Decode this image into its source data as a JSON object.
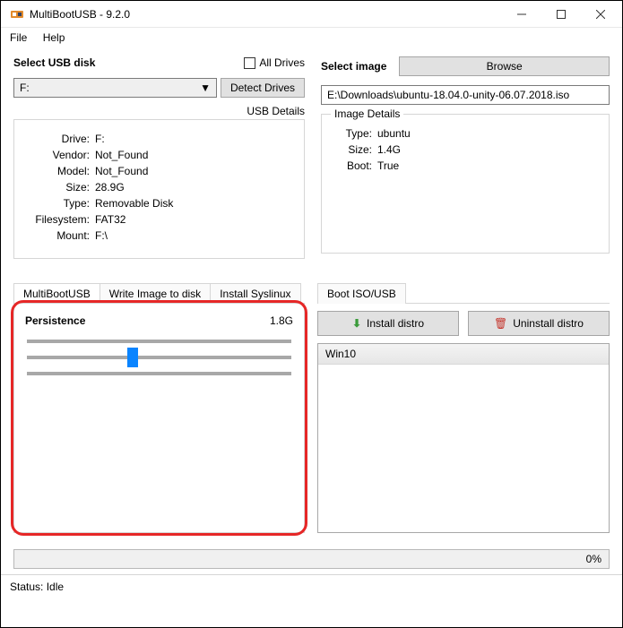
{
  "window": {
    "title": "MultiBootUSB - 9.2.0"
  },
  "menu": {
    "file": "File",
    "help": "Help"
  },
  "usb": {
    "select_label": "Select USB disk",
    "all_drives": "All Drives",
    "selected": "F:",
    "detect": "Detect Drives",
    "details_label": "USB Details",
    "drive_k": "Drive:",
    "drive_v": "F:",
    "vendor_k": "Vendor:",
    "vendor_v": "Not_Found",
    "model_k": "Model:",
    "model_v": "Not_Found",
    "size_k": "Size:",
    "size_v": "28.9G",
    "type_k": "Type:",
    "type_v": "Removable Disk",
    "fs_k": "Filesystem:",
    "fs_v": "FAT32",
    "mount_k": "Mount:",
    "mount_v": "F:\\"
  },
  "image": {
    "select_label": "Select image",
    "browse": "Browse",
    "path": "E:\\Downloads\\ubuntu-18.04.0-unity-06.07.2018.iso",
    "details_legend": "Image Details",
    "type_k": "Type:",
    "type_v": "ubuntu",
    "size_k": "Size:",
    "size_v": "1.4G",
    "boot_k": "Boot:",
    "boot_v": "True"
  },
  "tabs": {
    "multiboot": "MultiBootUSB",
    "write": "Write Image to disk",
    "syslinux": "Install Syslinux",
    "bootiso": "Boot ISO/USB"
  },
  "persistence": {
    "label": "Persistence",
    "value": "1.8G"
  },
  "actions": {
    "install": "Install distro",
    "uninstall": "Uninstall distro"
  },
  "list": {
    "item0": "Win10"
  },
  "progress": {
    "pct": "0%"
  },
  "status": {
    "label": "Status:",
    "value": "Idle"
  }
}
